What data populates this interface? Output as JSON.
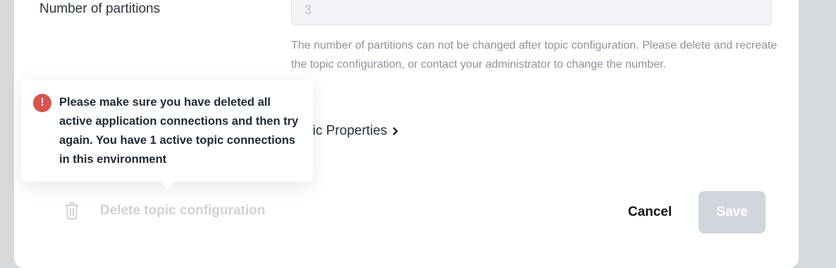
{
  "form": {
    "partitions_label": "Number of partitions",
    "partitions_value": "3",
    "partitions_help": "The number of partitions can not be changed after topic configuration. Please delete and recreate the topic configuration, or contact your administrator to change the number.",
    "topic_properties_link": "Topic Properties"
  },
  "tooltip": {
    "icon": "error-icon",
    "message": "Please make sure you have deleted all active application connections and then try again. You have 1 active topic connections in this environment"
  },
  "actions": {
    "delete_label": "Delete topic configuration",
    "delete_icon": "trash-icon",
    "cancel_label": "Cancel",
    "save_label": "Save"
  },
  "colors": {
    "error": "#d9534f",
    "disabled": "#d1d5dc"
  }
}
